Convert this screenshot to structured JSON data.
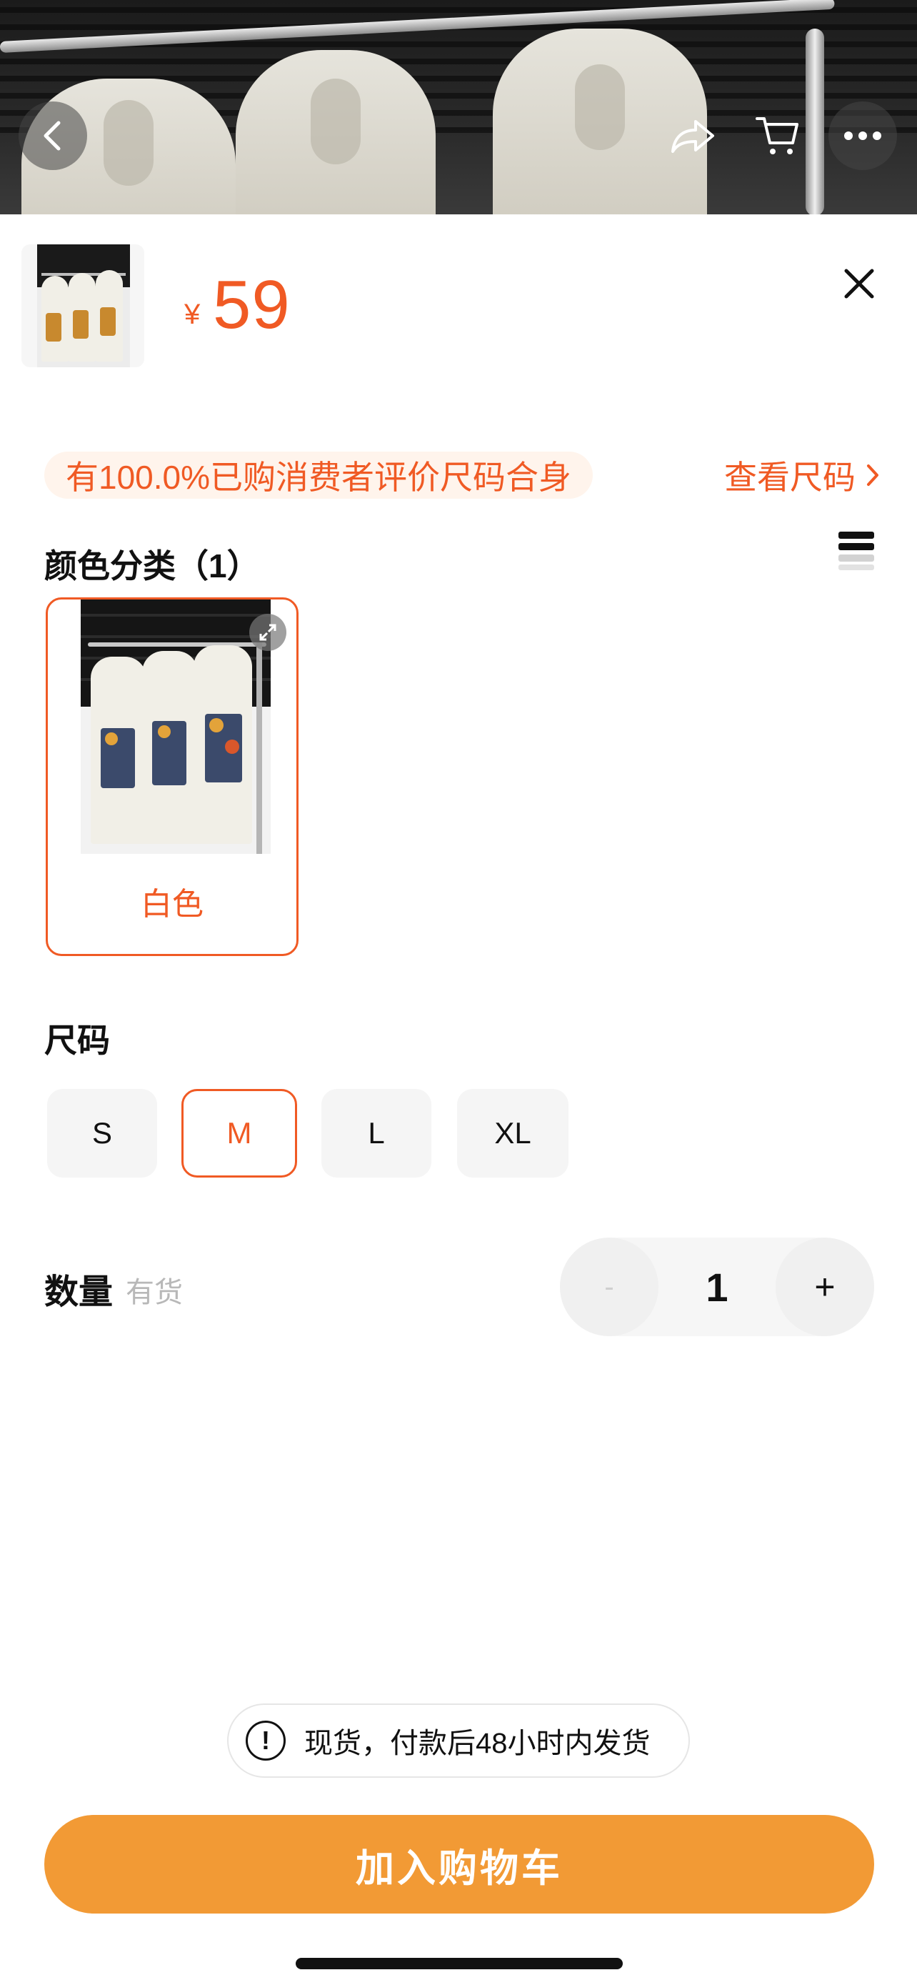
{
  "header": {
    "back_icon": "chevron-left-icon",
    "share_icon": "share-icon",
    "cart_icon": "cart-icon",
    "more_icon": "more-icon"
  },
  "product": {
    "currency": "¥",
    "price": "59"
  },
  "fit_notice": {
    "text": "有100.0%已购消费者评价尺码合身",
    "size_chart_link": "查看尺码"
  },
  "color_section": {
    "title": "颜色分类（1）",
    "options": [
      {
        "label": "白色",
        "selected": true
      }
    ]
  },
  "size_section": {
    "title": "尺码",
    "options": [
      {
        "label": "S",
        "selected": false
      },
      {
        "label": "M",
        "selected": true
      },
      {
        "label": "L",
        "selected": false
      },
      {
        "label": "XL",
        "selected": false
      }
    ]
  },
  "quantity": {
    "label": "数量",
    "stock": "有货",
    "minus": "-",
    "value": "1",
    "plus": "+"
  },
  "shipping_notice": "现货，付款后48小时内发货",
  "cta_label": "加入购物车",
  "colors": {
    "accent": "#f05a24",
    "cta": "#f29a35"
  }
}
